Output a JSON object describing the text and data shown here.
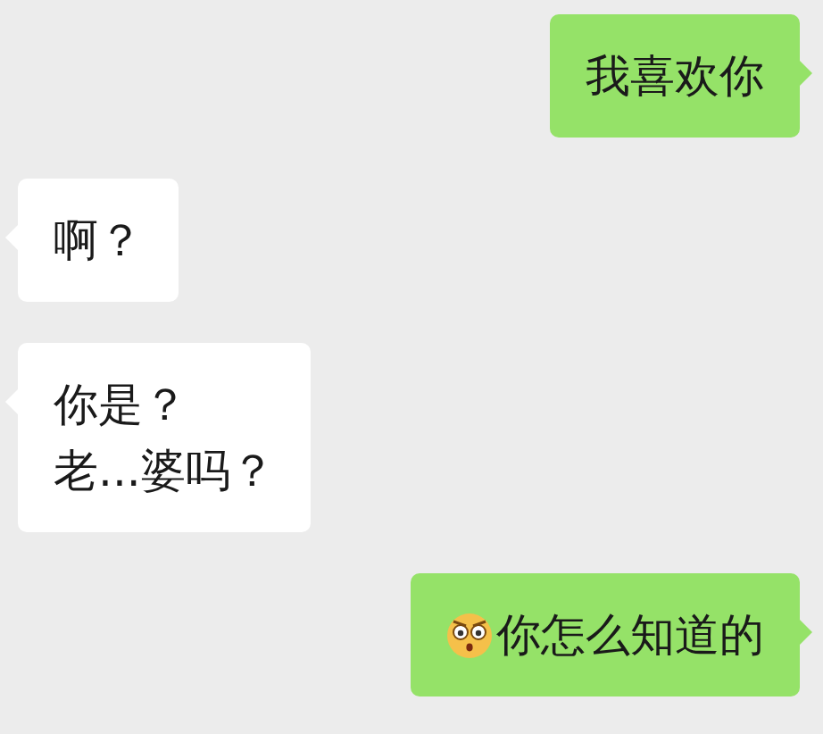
{
  "messages": [
    {
      "kind": "sent",
      "lines": [
        "我喜欢你"
      ],
      "emoji": false
    },
    {
      "kind": "received",
      "lines": [
        "啊？"
      ],
      "emoji": false
    },
    {
      "kind": "received",
      "lines": [
        "你是？",
        "老...婆吗？"
      ],
      "emoji": false
    },
    {
      "kind": "sent",
      "lines": [
        "你怎么知道的"
      ],
      "emoji": true
    }
  ]
}
